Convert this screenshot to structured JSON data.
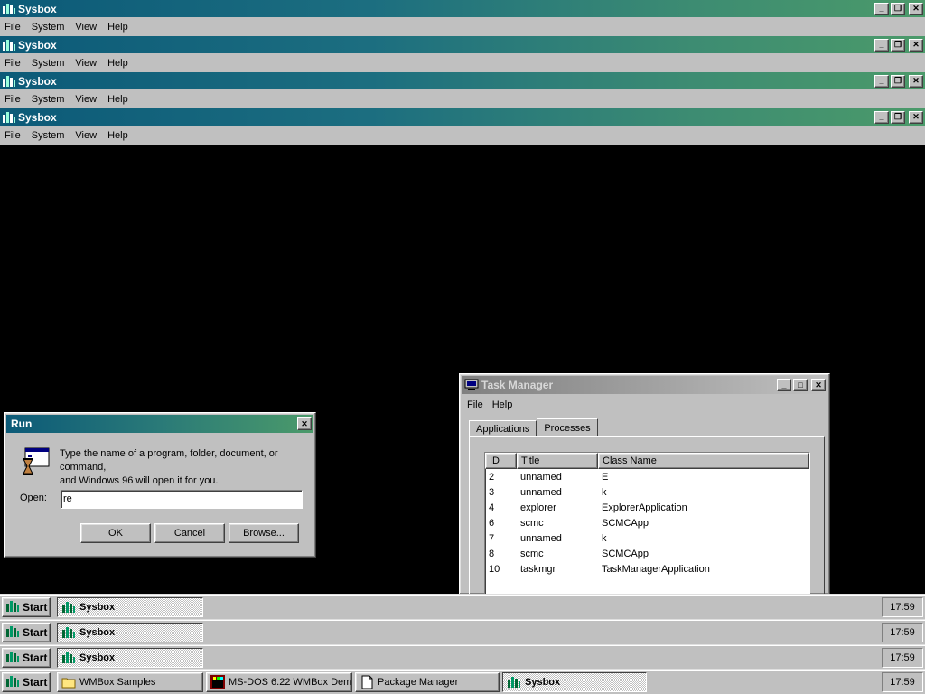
{
  "sysbox_windows": [
    {
      "title": "Sysbox",
      "menu": [
        "File",
        "System",
        "View",
        "Help"
      ]
    },
    {
      "title": "Sysbox",
      "menu": [
        "File",
        "System",
        "View",
        "Help"
      ]
    },
    {
      "title": "Sysbox",
      "menu": [
        "File",
        "System",
        "View",
        "Help"
      ]
    },
    {
      "title": "Sysbox",
      "menu": [
        "File",
        "System",
        "View",
        "Help"
      ]
    }
  ],
  "run_dialog": {
    "title": "Run",
    "description_line1": "Type the name of a program, folder, document, or command,",
    "description_line2": "and Windows 96 will open it for you.",
    "open_label": "Open:",
    "open_value": "re",
    "ok_label": "OK",
    "cancel_label": "Cancel",
    "browse_label": "Browse..."
  },
  "task_manager": {
    "title": "Task Manager",
    "menu": [
      "File",
      "Help"
    ],
    "tabs": [
      "Applications",
      "Processes"
    ],
    "active_tab": "Processes",
    "columns": [
      "ID",
      "Title",
      "Class Name"
    ],
    "rows": [
      {
        "id": "2",
        "title": "unnamed",
        "class": "E"
      },
      {
        "id": "3",
        "title": "unnamed",
        "class": "k"
      },
      {
        "id": "4",
        "title": "explorer",
        "class": "ExplorerApplication"
      },
      {
        "id": "6",
        "title": "scmc",
        "class": "SCMCApp"
      },
      {
        "id": "7",
        "title": "unnamed",
        "class": "k"
      },
      {
        "id": "8",
        "title": "scmc",
        "class": "SCMCApp"
      },
      {
        "id": "10",
        "title": "taskmgr",
        "class": "TaskManagerApplication"
      }
    ]
  },
  "taskbars": [
    {
      "start": "Start",
      "tasks": [
        {
          "label": "Sysbox",
          "icon": "sysbox-icon"
        }
      ],
      "clock": "17:59"
    },
    {
      "start": "Start",
      "tasks": [
        {
          "label": "Sysbox",
          "icon": "sysbox-icon"
        }
      ],
      "clock": "17:59"
    },
    {
      "start": "Start",
      "tasks": [
        {
          "label": "Sysbox",
          "icon": "sysbox-icon"
        }
      ],
      "clock": "17:59"
    },
    {
      "start": "Start",
      "tasks": [
        {
          "label": "WMBox Samples",
          "icon": "folder-icon"
        },
        {
          "label": "MS-DOS 6.22 WMBox Dem...",
          "icon": "msdos-icon"
        },
        {
          "label": "Package Manager",
          "icon": "document-icon"
        },
        {
          "label": "Sysbox",
          "icon": "sysbox-icon"
        }
      ],
      "clock": "17:59"
    }
  ],
  "colors": {
    "desktop": "#000000",
    "titlebar_active": "#0c5a78",
    "face": "#c0c0c0"
  }
}
